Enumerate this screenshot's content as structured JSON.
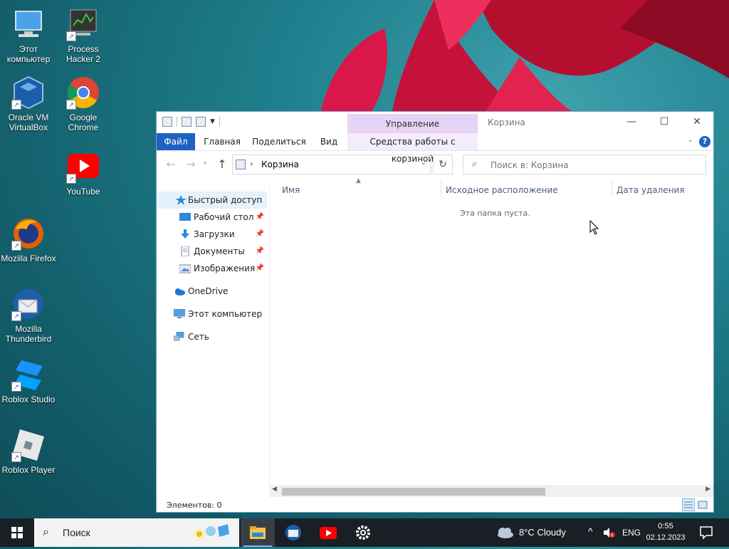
{
  "desktop": {
    "icons": [
      {
        "label": "Этот компьютер",
        "icon": "this-pc-icon"
      },
      {
        "label": "Process Hacker 2",
        "icon": "process-hacker-icon"
      },
      {
        "label": "Oracle VM VirtualBox",
        "icon": "virtualbox-icon"
      },
      {
        "label": "Google Chrome",
        "icon": "chrome-icon"
      },
      {
        "label": "YouTube",
        "icon": "youtube-icon"
      },
      {
        "label": "Mozilla Firefox",
        "icon": "firefox-icon"
      },
      {
        "label": "Mozilla Thunderbird",
        "icon": "thunderbird-icon"
      },
      {
        "label": "Roblox Studio",
        "icon": "roblox-studio-icon"
      },
      {
        "label": "Roblox Player",
        "icon": "roblox-player-icon"
      }
    ]
  },
  "explorer": {
    "title": "Корзина",
    "context_tab": "Управление",
    "ribbon_tabs": [
      "Файл",
      "Главная",
      "Поделиться",
      "Вид",
      "Средства работы с корзиной"
    ],
    "address": "Корзина",
    "search_placeholder": "Поиск в: Корзина",
    "nav": {
      "quick_access": "Быстрый доступ",
      "pinned": [
        "Рабочий стол",
        "Загрузки",
        "Документы",
        "Изображения"
      ],
      "onedrive": "OneDrive",
      "this_pc": "Этот компьютер",
      "network": "Сеть"
    },
    "columns": [
      "Имя",
      "Исходное расположение",
      "Дата удаления"
    ],
    "empty_text": "Эта папка пуста.",
    "status": "Элементов: 0",
    "scroll_position": 0.0
  },
  "taskbar": {
    "search_text": "Поиск",
    "weather": "8°C  Cloudy",
    "language": "ENG",
    "time": "0:55",
    "date": "02.12.2023"
  },
  "colors": {
    "accent": "#1f63c2",
    "context_tab": "#e7d3f5",
    "taskbar": "#1a1f26"
  }
}
